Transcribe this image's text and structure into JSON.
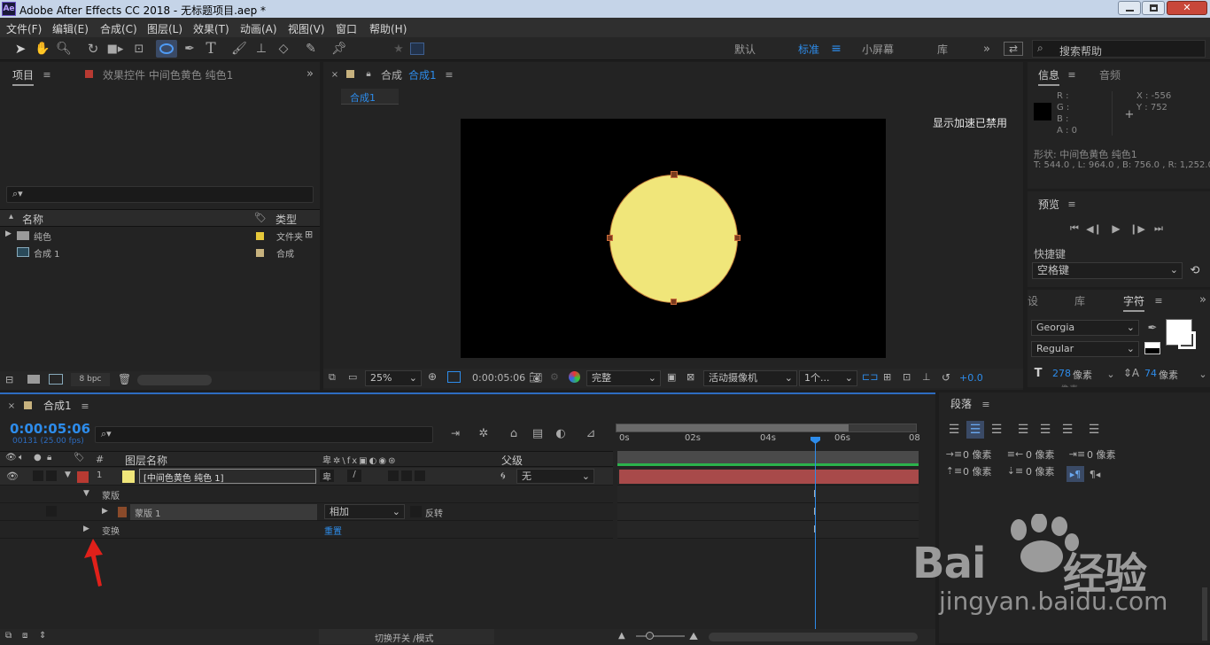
{
  "window": {
    "title": "Adobe After Effects CC 2018 - 无标题项目.aep *",
    "app_icon": "Ae"
  },
  "menu": [
    "文件(F)",
    "编辑(E)",
    "合成(C)",
    "图层(L)",
    "效果(T)",
    "动画(A)",
    "视图(V)",
    "窗口",
    "帮助(H)"
  ],
  "workspaces": {
    "items": [
      "默认",
      "标准",
      "小屏幕",
      "库"
    ],
    "active": "标准"
  },
  "search_help": {
    "placeholder": "搜索帮助"
  },
  "project_panel": {
    "tab_project": "项目",
    "tab_effects": "效果控件 中间色黄色 纯色1",
    "search_placeholder": "",
    "col_name": "名称",
    "col_type": "类型",
    "items": [
      {
        "name": "纯色",
        "type": "文件夹",
        "color": "#e6c83a"
      },
      {
        "name": "合成 1",
        "type": "合成",
        "color": "#c7b27e"
      }
    ],
    "bpc": "8 bpc"
  },
  "composition_panel": {
    "tab": "合成",
    "tab_name": "合成1",
    "sub_tab": "合成1",
    "gpu_notice": "显示加速已禁用",
    "zoom": "25%",
    "timecode": "0:00:05:06",
    "quality": "完整",
    "camera": "活动摄像机",
    "views": "1个...",
    "exposure": "+0.0",
    "circle_color": "#f0e67a"
  },
  "info_panel": {
    "tab_info": "信息",
    "tab_audio": "音频",
    "r": "R :",
    "g": "G :",
    "b": "B :",
    "a": "A : 0",
    "x": "X : -556",
    "y": "Y : 752",
    "shape_line": "形状: 中间色黄色 纯色1",
    "bounds_line": "T: 544.0 , L: 964.0 , B: 756.0 , R: 1,252.0"
  },
  "preview_panel": {
    "tab": "预览",
    "shortcut_label": "快捷键",
    "shortcut_value": "空格键"
  },
  "character_panel": {
    "tab_left": "设",
    "tab_lib": "库",
    "tab_char": "字符",
    "font": "Georgia",
    "style": "Regular",
    "size": "278",
    "size_unit": "像素",
    "leading": "74",
    "leading_unit": "像素",
    "cut_text": "一 像素"
  },
  "paragraph_panel": {
    "tab": "段落",
    "indent_left": "0 像素",
    "indent_right": "0 像素",
    "indent_first": "0 像素",
    "space_before": "0 像素",
    "space_after": "0 像素"
  },
  "timeline": {
    "tab": "合成1",
    "timecode": "0:00:05:06",
    "frames": "00131 (25.00 fps)",
    "search_placeholder": "",
    "col_num": "#",
    "col_layer": "图层名称",
    "col_parent": "父级",
    "layer": {
      "num": "1",
      "name": "[中间色黄色 纯色 1]",
      "label_color": "#b83a32",
      "swatch_color": "#f0e67a",
      "parent": "无"
    },
    "masks_label": "蒙版",
    "mask": {
      "name": "蒙版 1",
      "mode": "相加",
      "inverted_label": "反转",
      "color": "#8a4a2a"
    },
    "transform_label": "变换",
    "transform_reset": "重置",
    "ruler": [
      "0s",
      "02s",
      "04s",
      "06s",
      "08"
    ],
    "toggle_label": "切换开关 /模式",
    "bar_color": "#a84a4a"
  }
}
